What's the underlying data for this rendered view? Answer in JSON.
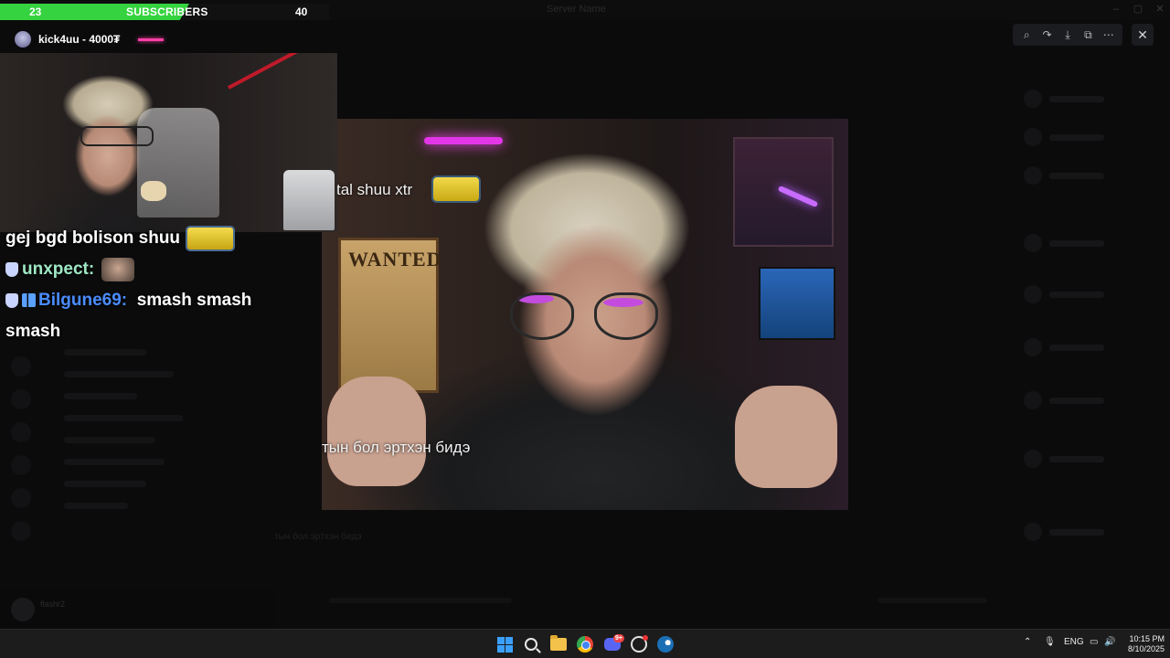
{
  "background_app": {
    "title": "Server Name",
    "user_panel_name": "flashr2"
  },
  "viewer_toolbar": {
    "tools": [
      {
        "name": "zoom-icon",
        "glyph": "⌕"
      },
      {
        "name": "share-icon",
        "glyph": "↷"
      },
      {
        "name": "download-icon",
        "glyph": "⤓"
      },
      {
        "name": "open-external-icon",
        "glyph": "⧉"
      },
      {
        "name": "more-icon",
        "glyph": "⋯"
      }
    ],
    "close_glyph": "✕"
  },
  "main_image": {
    "caption_top": "tal shuu xtr",
    "caption_bottom": "тын бол эртхэн бидэ",
    "poster_text": "WANTED"
  },
  "subscriber_goal": {
    "current": "23",
    "label": "SUBSCRIBERS",
    "goal": "40",
    "progress_fraction": 0.575
  },
  "donation": {
    "text": "kick4uu - 4000₮"
  },
  "chat": {
    "line1": "gej bgd bolison shuu",
    "msg2_user": "unxpect:",
    "msg3_user": "Bilgune69:",
    "msg3_text": "smash smash",
    "msg3_wrap": "smash"
  },
  "taskbar": {
    "tray_lang": "ENG",
    "time": "10:15 PM",
    "date": "8/10/2025",
    "discord_badge": "9+"
  },
  "colors": {
    "sub_bar_fill": "#35d33f",
    "unxpect_name": "#9fe8c5",
    "bilgune_name": "#4a8cff",
    "donation_accent": "#ff3fa6"
  }
}
